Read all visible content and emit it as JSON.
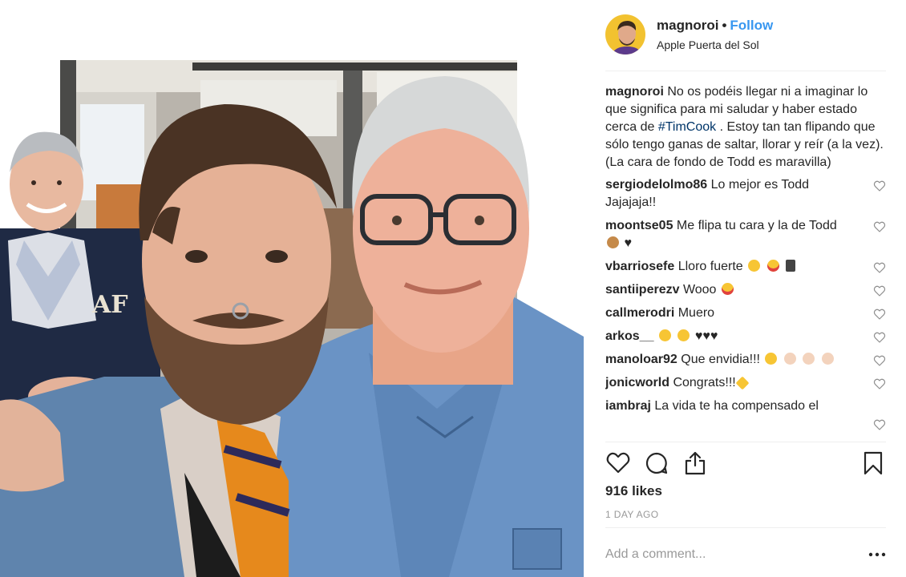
{
  "post": {
    "image_alt": "Selfie of two men in denim shirts inside an Apple Store; a smiling man in a cardigan stands in the background"
  },
  "header": {
    "username": "magnoroi",
    "separator": "•",
    "follow_label": "Follow",
    "location": "Apple Puerta del Sol"
  },
  "caption": {
    "username": "magnoroi",
    "text_before": "No os podéis llegar ni a imaginar lo que significa para mi saludar y haber estado cerca de ",
    "hashtag": "#TimCook",
    "text_after": " . Estoy tan tan flipando que sólo tengo ganas de saltar, llorar y reír (a la vez). (La cara de fondo de Todd es maravilla)"
  },
  "comments": [
    {
      "username": "sergiodelolmo86",
      "text": "Lo mejor es Todd Jajajaja!!"
    },
    {
      "username": "moontse05",
      "text": "Me flipa tu cara y la de Todd",
      "tail": "♥"
    },
    {
      "username": "vbarriosefe",
      "text": "Lloro fuerte"
    },
    {
      "username": "santiiperezv",
      "text": "Wooo"
    },
    {
      "username": "callmerodri",
      "text": "Muero"
    },
    {
      "username": "arkos__",
      "text": "",
      "tail": "♥♥♥"
    },
    {
      "username": "manoloar92",
      "text": "Que envidia!!!"
    },
    {
      "username": "jonicworld",
      "text": "Congrats!!!"
    },
    {
      "username": "iambraj",
      "text": "La vida te ha compensado el"
    }
  ],
  "likes": "916 likes",
  "timestamp": "1 DAY AGO",
  "add_comment_placeholder": "Add a comment...",
  "icons": [
    "like-icon",
    "comment-icon",
    "share-icon",
    "save-icon",
    "more-options-icon",
    "comment-like-icon"
  ],
  "colors": {
    "follow": "#3897f0",
    "hashtag": "#003569",
    "muted": "#999999",
    "text": "#262626",
    "divider": "#efefef"
  }
}
